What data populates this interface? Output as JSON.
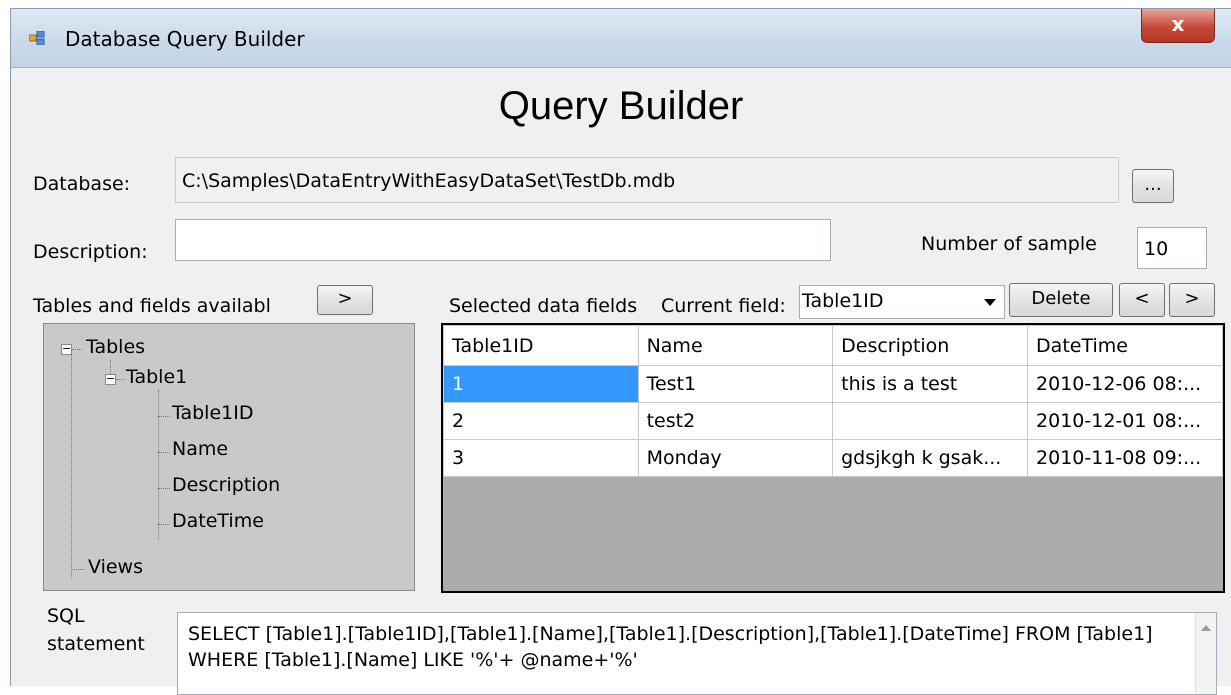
{
  "window": {
    "title": "Database Query Builder",
    "close_label": "x"
  },
  "heading": "Query Builder",
  "database": {
    "label": "Database:",
    "value": "C:\\Samples\\DataEntryWithEasyDataSet\\TestDb.mdb",
    "browse_label": "..."
  },
  "description": {
    "label": "Description:",
    "value": ""
  },
  "sample": {
    "label": "Number of sample",
    "value": "10"
  },
  "tables_panel": {
    "label": "Tables and fields availabl",
    "add_label": ">",
    "tree": {
      "root": "Tables",
      "table": "Table1",
      "fields": [
        "Table1ID",
        "Name",
        "Description",
        "DateTime"
      ],
      "views": "Views"
    }
  },
  "selected": {
    "label": "Selected data fields",
    "current_label": "Current field:",
    "current_value": "Table1ID",
    "delete_label": "Delete",
    "prev_label": "<",
    "next_label": ">"
  },
  "grid": {
    "columns": [
      "Table1ID",
      "Name",
      "Description",
      "DateTime"
    ],
    "rows": [
      [
        "1",
        "Test1",
        "this is a test",
        "2010-12-06 08:..."
      ],
      [
        "2",
        "test2",
        "",
        "2010-12-01 08:..."
      ],
      [
        "3",
        "Monday",
        "gdsjkgh k gsak...",
        "2010-11-08 09:..."
      ]
    ]
  },
  "sql": {
    "label_line1": "SQL",
    "label_line2": "statement",
    "value": "SELECT  [Table1].[Table1ID],[Table1].[Name],[Table1].[Description],[Table1].[DateTime] FROM [Table1] WHERE [Table1].[Name] LIKE '%'+ @name+'%'"
  }
}
